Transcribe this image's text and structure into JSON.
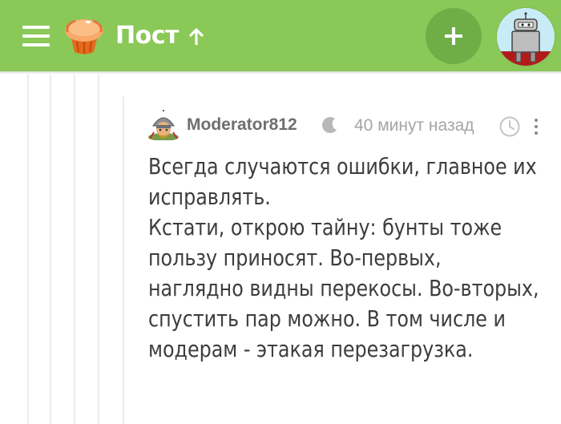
{
  "header": {
    "title": "Пост",
    "menu_icon": "hamburger-menu-icon",
    "logo_icon": "cupcake-logo-icon",
    "scroll_up_icon": "arrow-up-icon",
    "add_icon": "plus-icon",
    "colors": {
      "bar": "#8ac858",
      "add_button": "#70ad47"
    }
  },
  "comment": {
    "author": "Moderator812",
    "badge_icon": "crescent-moon-icon",
    "timestamp": "40 минут назад",
    "clock_icon": "clock-icon",
    "more_icon": "vertical-dots-icon",
    "paragraphs": [
      "Всегда случаются ошибки, главное их исправлять.",
      "Кстати, открою тайну: бунты тоже пользу приносят. Во-первых, наглядно видны перекосы. Во-вторых, спустить пар можно. В том числе и модерам - этакая перезагрузка."
    ]
  }
}
